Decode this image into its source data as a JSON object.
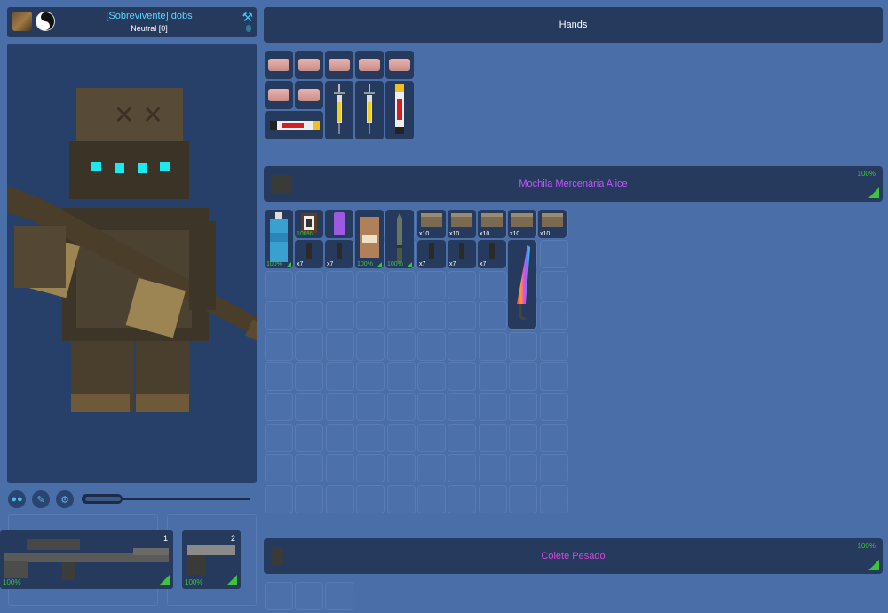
{
  "character": {
    "name": "[Sobrevivente] dobs",
    "status": "Neutral [0]"
  },
  "weapons": [
    {
      "number": "1",
      "durability": "100%"
    },
    {
      "number": "2",
      "durability": "100%"
    }
  ],
  "hands": {
    "title": "Hands"
  },
  "backpack": {
    "title": "Mochila Mercenária Alice",
    "durability": "100%",
    "title_color": "#c455ff"
  },
  "vest": {
    "title": "Colete Pesado",
    "durability": "100%",
    "title_color": "#d14ad8"
  },
  "backpack_items": {
    "water_pct": "100%",
    "battery_pct": "100%",
    "mre_pct": "100%",
    "knife_pct": "100%",
    "ammo_top_1": "x10",
    "ammo_top_2": "x10",
    "ammo_top_3": "x10",
    "ammo_top_4": "x10",
    "ammo_top_5": "x10",
    "mag_1": "x7",
    "mag_2": "x7",
    "mag_3": "x7",
    "mag_4": "x7",
    "mag_5": "x7"
  },
  "colors": {
    "accent": "#5ad6ff",
    "durability_green": "#3cc43c",
    "panel": "#263a5e",
    "background": "#4a6ea8"
  },
  "icons": {
    "character_settings": "people-icon",
    "paint": "brush-icon",
    "tools": "wrench-icon",
    "build": "hammer-icon"
  }
}
